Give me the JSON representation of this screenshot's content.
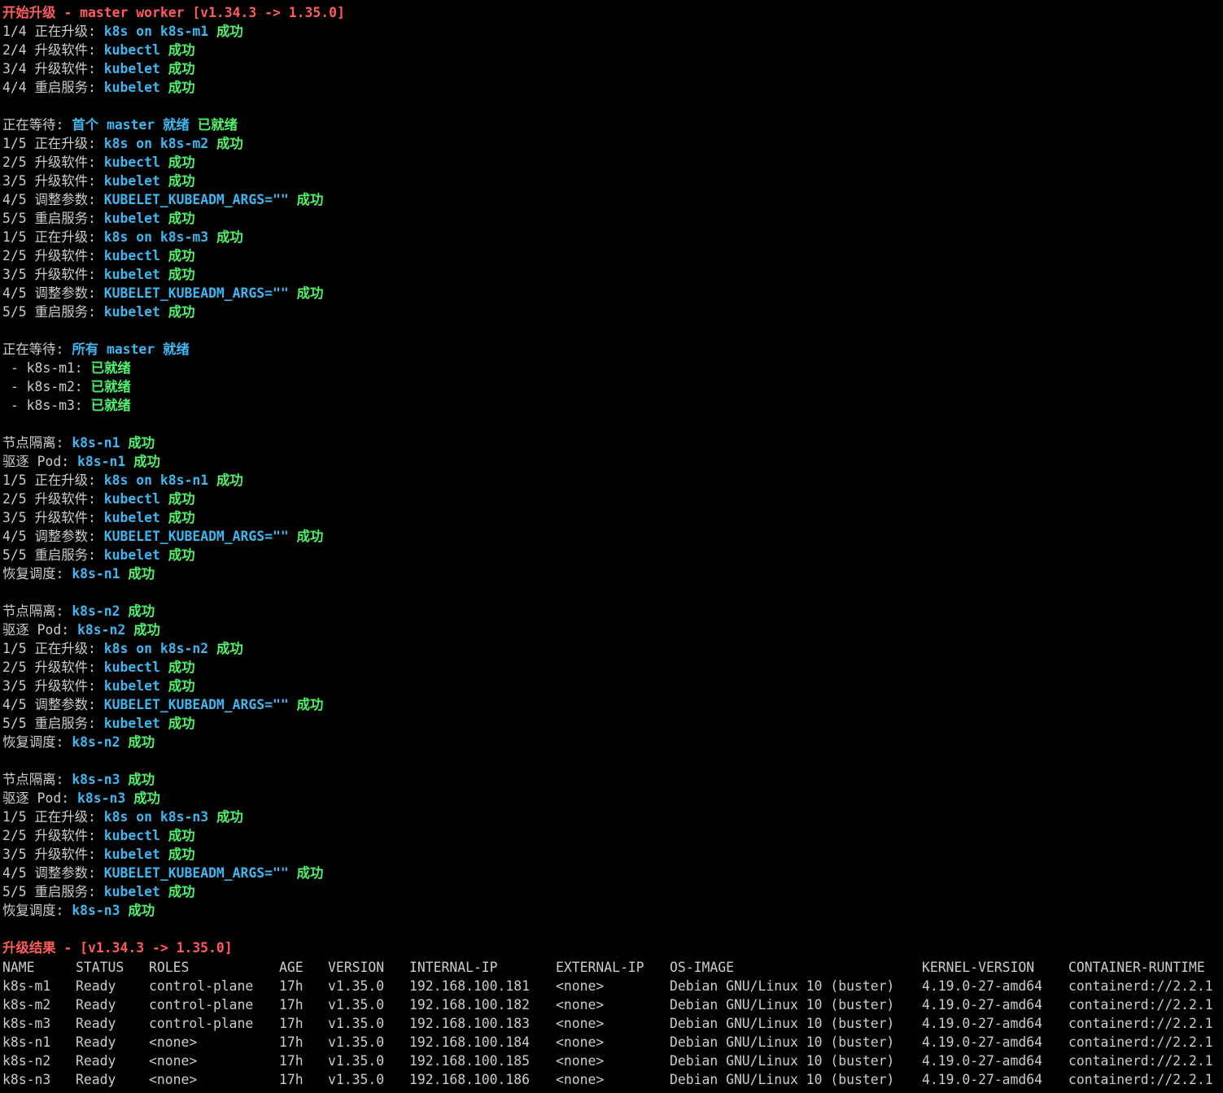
{
  "palette": {
    "background": "#000000",
    "text": "#cccccc",
    "red": "#ff5c5c",
    "cyan": "#3eb6f0",
    "green": "#4ff36b"
  },
  "log": [
    [
      [
        "开始升级 - master worker [v1.34.3 -> 1.35.0]",
        "red",
        true
      ]
    ],
    [
      [
        "1/4 正在升级: ",
        "white",
        false
      ],
      [
        "k8s on k8s-m1",
        "cyan",
        true
      ],
      [
        " 成功",
        "green",
        true
      ]
    ],
    [
      [
        "2/4 升级软件: ",
        "white",
        false
      ],
      [
        "kubectl",
        "cyan",
        true
      ],
      [
        " 成功",
        "green",
        true
      ]
    ],
    [
      [
        "3/4 升级软件: ",
        "white",
        false
      ],
      [
        "kubelet",
        "cyan",
        true
      ],
      [
        " 成功",
        "green",
        true
      ]
    ],
    [
      [
        "4/4 重启服务: ",
        "white",
        false
      ],
      [
        "kubelet",
        "cyan",
        true
      ],
      [
        " 成功",
        "green",
        true
      ]
    ],
    [],
    [
      [
        "正在等待: ",
        "white",
        false
      ],
      [
        "首个 master 就绪",
        "cyan",
        true
      ],
      [
        " 已就绪",
        "green",
        true
      ]
    ],
    [
      [
        "1/5 正在升级: ",
        "white",
        false
      ],
      [
        "k8s on k8s-m2",
        "cyan",
        true
      ],
      [
        " 成功",
        "green",
        true
      ]
    ],
    [
      [
        "2/5 升级软件: ",
        "white",
        false
      ],
      [
        "kubectl",
        "cyan",
        true
      ],
      [
        " 成功",
        "green",
        true
      ]
    ],
    [
      [
        "3/5 升级软件: ",
        "white",
        false
      ],
      [
        "kubelet",
        "cyan",
        true
      ],
      [
        " 成功",
        "green",
        true
      ]
    ],
    [
      [
        "4/5 调整参数: ",
        "white",
        false
      ],
      [
        "KUBELET_KUBEADM_ARGS=\"\"",
        "cyan",
        true
      ],
      [
        " 成功",
        "green",
        true
      ]
    ],
    [
      [
        "5/5 重启服务: ",
        "white",
        false
      ],
      [
        "kubelet",
        "cyan",
        true
      ],
      [
        " 成功",
        "green",
        true
      ]
    ],
    [
      [
        "1/5 正在升级: ",
        "white",
        false
      ],
      [
        "k8s on k8s-m3",
        "cyan",
        true
      ],
      [
        " 成功",
        "green",
        true
      ]
    ],
    [
      [
        "2/5 升级软件: ",
        "white",
        false
      ],
      [
        "kubectl",
        "cyan",
        true
      ],
      [
        " 成功",
        "green",
        true
      ]
    ],
    [
      [
        "3/5 升级软件: ",
        "white",
        false
      ],
      [
        "kubelet",
        "cyan",
        true
      ],
      [
        " 成功",
        "green",
        true
      ]
    ],
    [
      [
        "4/5 调整参数: ",
        "white",
        false
      ],
      [
        "KUBELET_KUBEADM_ARGS=\"\"",
        "cyan",
        true
      ],
      [
        " 成功",
        "green",
        true
      ]
    ],
    [
      [
        "5/5 重启服务: ",
        "white",
        false
      ],
      [
        "kubelet",
        "cyan",
        true
      ],
      [
        " 成功",
        "green",
        true
      ]
    ],
    [],
    [
      [
        "正在等待: ",
        "white",
        false
      ],
      [
        "所有 master 就绪",
        "cyan",
        true
      ]
    ],
    [
      [
        " - k8s-m1: ",
        "white",
        false
      ],
      [
        "已就绪",
        "green",
        true
      ]
    ],
    [
      [
        " - k8s-m2: ",
        "white",
        false
      ],
      [
        "已就绪",
        "green",
        true
      ]
    ],
    [
      [
        " - k8s-m3: ",
        "white",
        false
      ],
      [
        "已就绪",
        "green",
        true
      ]
    ],
    [],
    [
      [
        "节点隔离: ",
        "white",
        false
      ],
      [
        "k8s-n1",
        "cyan",
        true
      ],
      [
        " 成功",
        "green",
        true
      ]
    ],
    [
      [
        "驱逐 Pod: ",
        "white",
        false
      ],
      [
        "k8s-n1",
        "cyan",
        true
      ],
      [
        " 成功",
        "green",
        true
      ]
    ],
    [
      [
        "1/5 正在升级: ",
        "white",
        false
      ],
      [
        "k8s on k8s-n1",
        "cyan",
        true
      ],
      [
        " 成功",
        "green",
        true
      ]
    ],
    [
      [
        "2/5 升级软件: ",
        "white",
        false
      ],
      [
        "kubectl",
        "cyan",
        true
      ],
      [
        " 成功",
        "green",
        true
      ]
    ],
    [
      [
        "3/5 升级软件: ",
        "white",
        false
      ],
      [
        "kubelet",
        "cyan",
        true
      ],
      [
        " 成功",
        "green",
        true
      ]
    ],
    [
      [
        "4/5 调整参数: ",
        "white",
        false
      ],
      [
        "KUBELET_KUBEADM_ARGS=\"\"",
        "cyan",
        true
      ],
      [
        " 成功",
        "green",
        true
      ]
    ],
    [
      [
        "5/5 重启服务: ",
        "white",
        false
      ],
      [
        "kubelet",
        "cyan",
        true
      ],
      [
        " 成功",
        "green",
        true
      ]
    ],
    [
      [
        "恢复调度: ",
        "white",
        false
      ],
      [
        "k8s-n1",
        "cyan",
        true
      ],
      [
        " 成功",
        "green",
        true
      ]
    ],
    [],
    [
      [
        "节点隔离: ",
        "white",
        false
      ],
      [
        "k8s-n2",
        "cyan",
        true
      ],
      [
        " 成功",
        "green",
        true
      ]
    ],
    [
      [
        "驱逐 Pod: ",
        "white",
        false
      ],
      [
        "k8s-n2",
        "cyan",
        true
      ],
      [
        " 成功",
        "green",
        true
      ]
    ],
    [
      [
        "1/5 正在升级: ",
        "white",
        false
      ],
      [
        "k8s on k8s-n2",
        "cyan",
        true
      ],
      [
        " 成功",
        "green",
        true
      ]
    ],
    [
      [
        "2/5 升级软件: ",
        "white",
        false
      ],
      [
        "kubectl",
        "cyan",
        true
      ],
      [
        " 成功",
        "green",
        true
      ]
    ],
    [
      [
        "3/5 升级软件: ",
        "white",
        false
      ],
      [
        "kubelet",
        "cyan",
        true
      ],
      [
        " 成功",
        "green",
        true
      ]
    ],
    [
      [
        "4/5 调整参数: ",
        "white",
        false
      ],
      [
        "KUBELET_KUBEADM_ARGS=\"\"",
        "cyan",
        true
      ],
      [
        " 成功",
        "green",
        true
      ]
    ],
    [
      [
        "5/5 重启服务: ",
        "white",
        false
      ],
      [
        "kubelet",
        "cyan",
        true
      ],
      [
        " 成功",
        "green",
        true
      ]
    ],
    [
      [
        "恢复调度: ",
        "white",
        false
      ],
      [
        "k8s-n2",
        "cyan",
        true
      ],
      [
        " 成功",
        "green",
        true
      ]
    ],
    [],
    [
      [
        "节点隔离: ",
        "white",
        false
      ],
      [
        "k8s-n3",
        "cyan",
        true
      ],
      [
        " 成功",
        "green",
        true
      ]
    ],
    [
      [
        "驱逐 Pod: ",
        "white",
        false
      ],
      [
        "k8s-n3",
        "cyan",
        true
      ],
      [
        " 成功",
        "green",
        true
      ]
    ],
    [
      [
        "1/5 正在升级: ",
        "white",
        false
      ],
      [
        "k8s on k8s-n3",
        "cyan",
        true
      ],
      [
        " 成功",
        "green",
        true
      ]
    ],
    [
      [
        "2/5 升级软件: ",
        "white",
        false
      ],
      [
        "kubectl",
        "cyan",
        true
      ],
      [
        " 成功",
        "green",
        true
      ]
    ],
    [
      [
        "3/5 升级软件: ",
        "white",
        false
      ],
      [
        "kubelet",
        "cyan",
        true
      ],
      [
        " 成功",
        "green",
        true
      ]
    ],
    [
      [
        "4/5 调整参数: ",
        "white",
        false
      ],
      [
        "KUBELET_KUBEADM_ARGS=\"\"",
        "cyan",
        true
      ],
      [
        " 成功",
        "green",
        true
      ]
    ],
    [
      [
        "5/5 重启服务: ",
        "white",
        false
      ],
      [
        "kubelet",
        "cyan",
        true
      ],
      [
        " 成功",
        "green",
        true
      ]
    ],
    [
      [
        "恢复调度: ",
        "white",
        false
      ],
      [
        "k8s-n3",
        "cyan",
        true
      ],
      [
        " 成功",
        "green",
        true
      ]
    ],
    [],
    [
      [
        "升级结果 - [v1.34.3 -> 1.35.0]",
        "red",
        true
      ]
    ]
  ],
  "nodes_table": {
    "columns": [
      "NAME",
      "STATUS",
      "ROLES",
      "AGE",
      "VERSION",
      "INTERNAL-IP",
      "EXTERNAL-IP",
      "OS-IMAGE",
      "KERNEL-VERSION",
      "CONTAINER-RUNTIME"
    ],
    "rows": [
      [
        "k8s-m1",
        "Ready",
        "control-plane",
        "17h",
        "v1.35.0",
        "192.168.100.181",
        "<none>",
        "Debian GNU/Linux 10 (buster)",
        "4.19.0-27-amd64",
        "containerd://2.2.1"
      ],
      [
        "k8s-m2",
        "Ready",
        "control-plane",
        "17h",
        "v1.35.0",
        "192.168.100.182",
        "<none>",
        "Debian GNU/Linux 10 (buster)",
        "4.19.0-27-amd64",
        "containerd://2.2.1"
      ],
      [
        "k8s-m3",
        "Ready",
        "control-plane",
        "17h",
        "v1.35.0",
        "192.168.100.183",
        "<none>",
        "Debian GNU/Linux 10 (buster)",
        "4.19.0-27-amd64",
        "containerd://2.2.1"
      ],
      [
        "k8s-n1",
        "Ready",
        "<none>",
        "17h",
        "v1.35.0",
        "192.168.100.184",
        "<none>",
        "Debian GNU/Linux 10 (buster)",
        "4.19.0-27-amd64",
        "containerd://2.2.1"
      ],
      [
        "k8s-n2",
        "Ready",
        "<none>",
        "17h",
        "v1.35.0",
        "192.168.100.185",
        "<none>",
        "Debian GNU/Linux 10 (buster)",
        "4.19.0-27-amd64",
        "containerd://2.2.1"
      ],
      [
        "k8s-n3",
        "Ready",
        "<none>",
        "17h",
        "v1.35.0",
        "192.168.100.186",
        "<none>",
        "Debian GNU/Linux 10 (buster)",
        "4.19.0-27-amd64",
        "containerd://2.2.1"
      ]
    ]
  }
}
